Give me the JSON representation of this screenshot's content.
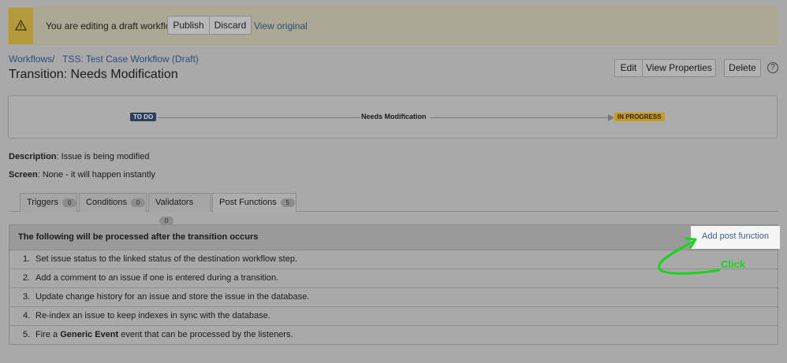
{
  "banner": {
    "message": "You are editing a draft workflow.",
    "publish_label": "Publish",
    "discard_label": "Discard",
    "view_original_label": "View original",
    "icon": "warning-icon"
  },
  "breadcrumb": {
    "workflows": "Workflows",
    "separator": "/",
    "workflow_name": "TSS: Test Case Workflow (Draft)"
  },
  "page_title": "Transition: Needs Modification",
  "toolbar": {
    "edit_label": "Edit",
    "view_properties_label": "View Properties",
    "delete_label": "Delete",
    "help_label": "?"
  },
  "diagram": {
    "from_status": "TO DO",
    "transition_name": "Needs Modification",
    "to_status": "IN PROGRESS"
  },
  "details": {
    "description_label": "Description",
    "description_value": ": Issue is being modified",
    "screen_label": "Screen",
    "screen_value": ": None - it will happen instantly"
  },
  "tabs": [
    {
      "label": "Triggers",
      "count": "0"
    },
    {
      "label": "Conditions",
      "count": "0"
    },
    {
      "label": "Validators",
      "count": "0"
    },
    {
      "label": "Post Functions",
      "count": "5"
    }
  ],
  "post_functions": {
    "header": "The following will be processed after the transition occurs",
    "add_label": "Add post function",
    "items": [
      {
        "num": "1.",
        "text": "Set issue status to the linked status of the destination workflow step."
      },
      {
        "num": "2.",
        "text": "Add a comment to an issue if one is entered during a transition."
      },
      {
        "num": "3.",
        "text": "Update change history for an issue and store the issue in the database."
      },
      {
        "num": "4.",
        "text": "Re-index an issue to keep indexes in sync with the database."
      },
      {
        "num": "5.",
        "pre": "Fire a ",
        "bold": "Generic Event",
        "post": " event that can be processed by the listeners."
      }
    ]
  },
  "annotation": {
    "click_label": "Click",
    "color": "#17d61a"
  }
}
